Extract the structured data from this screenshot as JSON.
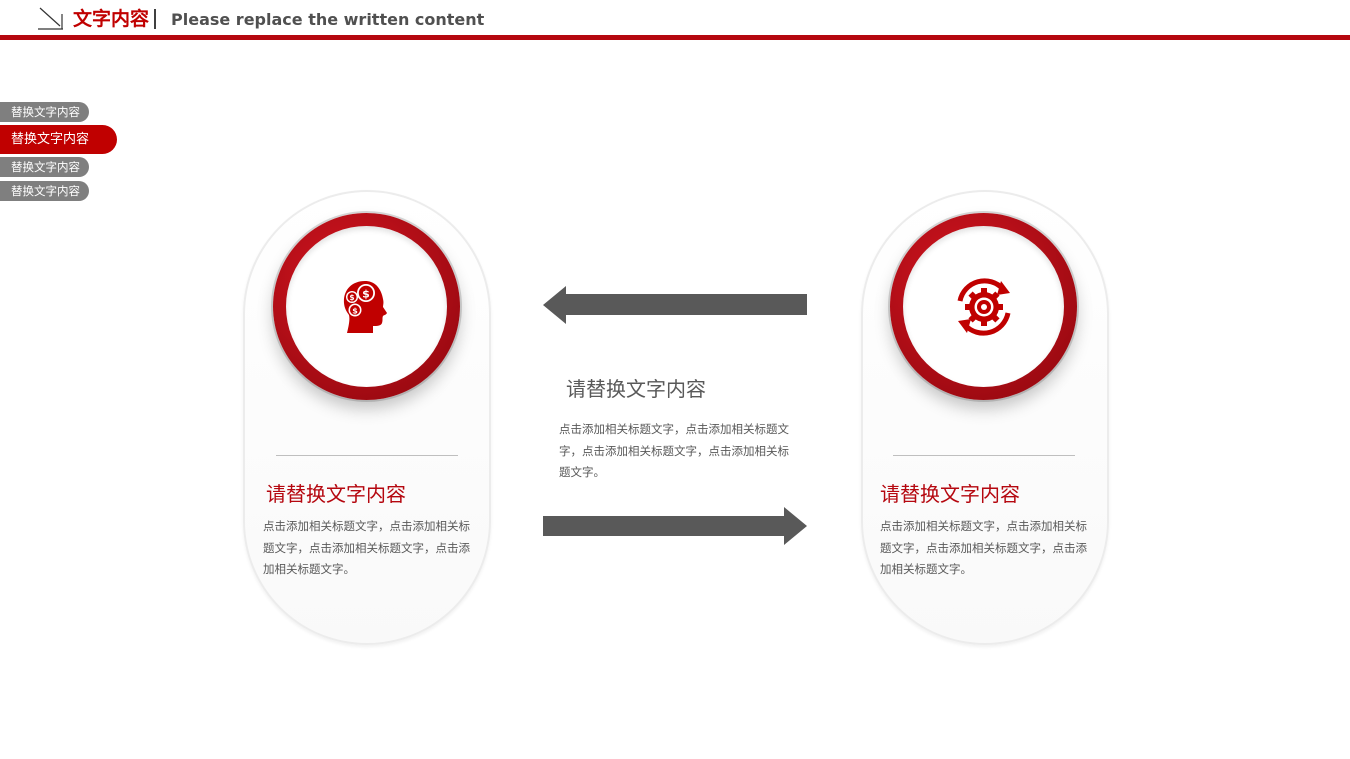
{
  "header": {
    "title": "文字内容",
    "subtitle": "Please replace the written content"
  },
  "side_nav": {
    "items": [
      {
        "label": "替换文字内容",
        "active": false
      },
      {
        "label": "替换文字内容",
        "active": true
      },
      {
        "label": "替换文字内容",
        "active": false
      },
      {
        "label": "替换文字内容",
        "active": false
      }
    ]
  },
  "left_card": {
    "icon": "head-money-icon",
    "title": "请替换文字内容",
    "body": "点击添加相关标题文字，点击添加相关标题文字，点击添加相关标题文字，点击添加相关标题文字。"
  },
  "right_card": {
    "icon": "gear-cycle-icon",
    "title": "请替换文字内容",
    "body": "点击添加相关标题文字，点击添加相关标题文字，点击添加相关标题文字，点击添加相关标题文字。"
  },
  "center": {
    "title": "请替换文字内容",
    "body": "点击添加相关标题文字，点击添加相关标题文字，点击添加相关标题文字，点击添加相关标题文字。"
  },
  "colors": {
    "accent": "#b5070f",
    "gray": "#595959",
    "nav_gray": "#7f7f7f"
  }
}
